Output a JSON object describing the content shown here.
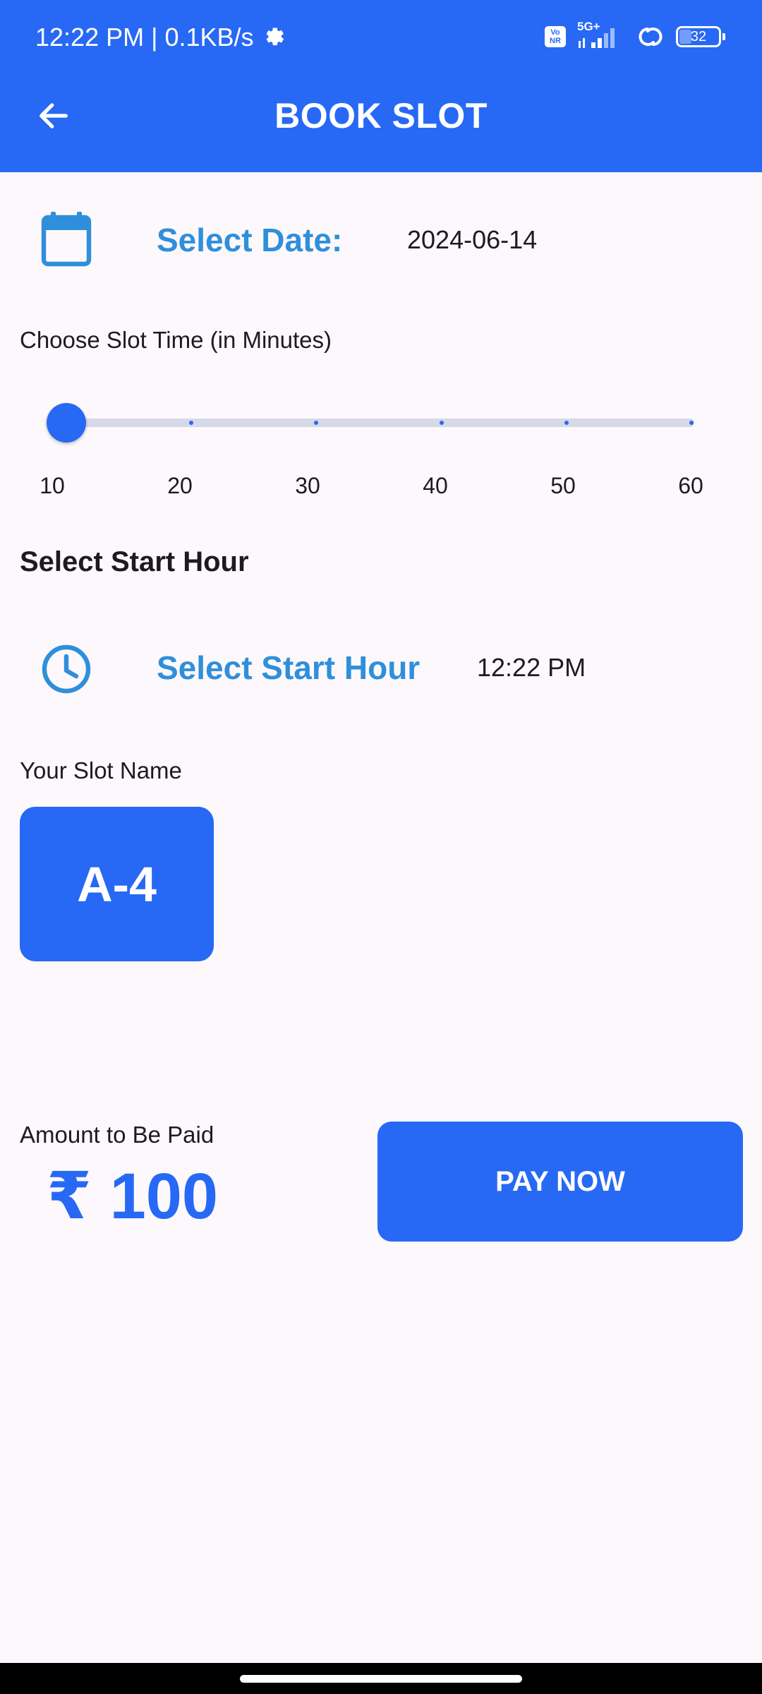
{
  "status_bar": {
    "time_and_speed": "12:22 PM | 0.1KB/s",
    "volte_label": "Vo NR",
    "network_type": "5G+",
    "battery_level": "32",
    "icons": [
      "gear-icon",
      "volte-icon",
      "signal-icon",
      "link-icon",
      "battery-icon"
    ]
  },
  "app_bar": {
    "title": "BOOK SLOT",
    "back_icon": "arrow-left-icon",
    "background_color": "#2769f5"
  },
  "date_row": {
    "icon": "calendar-icon",
    "label": "Select Date:",
    "value": "2024-06-14"
  },
  "slot_time": {
    "label": "Choose Slot Time (in Minutes)",
    "ticks": [
      "10",
      "20",
      "30",
      "40",
      "50",
      "60"
    ],
    "selected_value": 10
  },
  "start_hour": {
    "heading": "Select Start Hour",
    "icon": "clock-icon",
    "label": "Select Start Hour",
    "value": "12:22 PM"
  },
  "slot_name": {
    "label": "Your Slot Name",
    "value": "A-4"
  },
  "payment": {
    "label": "Amount to Be Paid",
    "amount": "₹ 100",
    "button_label": "PAY NOW"
  },
  "colors": {
    "accent": "#2769f5",
    "label_blue": "#2f8fdb",
    "background": "#fdf8fc"
  }
}
